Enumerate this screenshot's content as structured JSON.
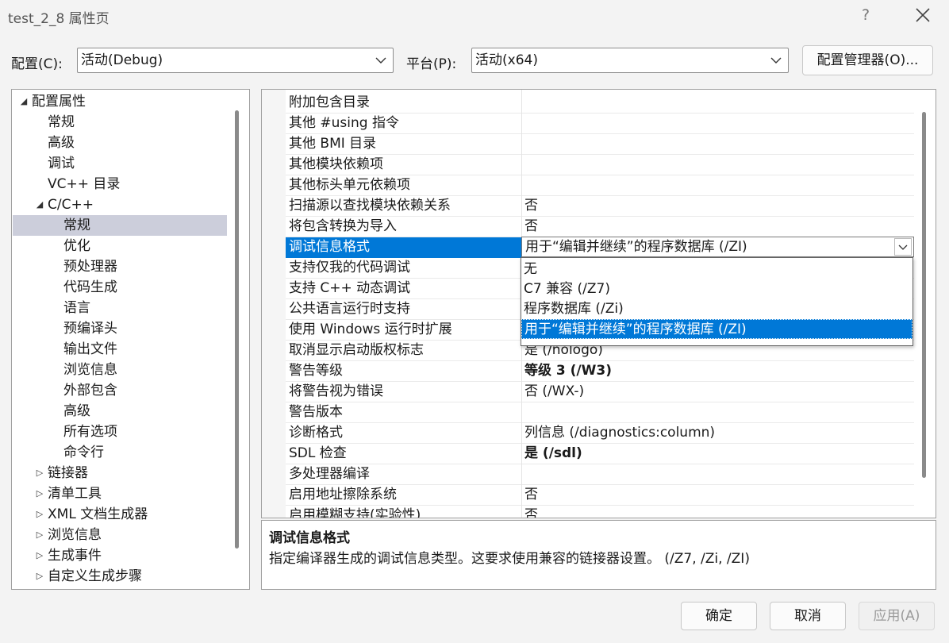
{
  "window": {
    "title": "test_2_8 属性页",
    "help_label": "?"
  },
  "config": {
    "config_label": "配置(C):",
    "config_value": "活动(Debug)",
    "platform_label": "平台(P):",
    "platform_value": "活动(x64)",
    "manager_label": "配置管理器(O)..."
  },
  "tree": {
    "items": [
      {
        "label": "配置属性",
        "toggle": "◢",
        "level": 0
      },
      {
        "label": "常规",
        "level": 1
      },
      {
        "label": "高级",
        "level": 1
      },
      {
        "label": "调试",
        "level": 1
      },
      {
        "label": "VC++ 目录",
        "level": 1
      },
      {
        "label": "C/C++",
        "toggle": "◢",
        "level": 1
      },
      {
        "label": "常规",
        "level": 2,
        "selected": true
      },
      {
        "label": "优化",
        "level": 2
      },
      {
        "label": "预处理器",
        "level": 2
      },
      {
        "label": "代码生成",
        "level": 2
      },
      {
        "label": "语言",
        "level": 2
      },
      {
        "label": "预编译头",
        "level": 2
      },
      {
        "label": "输出文件",
        "level": 2
      },
      {
        "label": "浏览信息",
        "level": 2
      },
      {
        "label": "外部包含",
        "level": 2
      },
      {
        "label": "高级",
        "level": 2
      },
      {
        "label": "所有选项",
        "level": 2
      },
      {
        "label": "命令行",
        "level": 2
      },
      {
        "label": "链接器",
        "toggle": "▷",
        "level": 1
      },
      {
        "label": "清单工具",
        "toggle": "▷",
        "level": 1
      },
      {
        "label": "XML 文档生成器",
        "toggle": "▷",
        "level": 1
      },
      {
        "label": "浏览信息",
        "toggle": "▷",
        "level": 1
      },
      {
        "label": "生成事件",
        "toggle": "▷",
        "level": 1
      },
      {
        "label": "自定义生成步骤",
        "toggle": "▷",
        "level": 1
      }
    ]
  },
  "grid": {
    "rows": [
      {
        "name": "附加包含目录",
        "value": ""
      },
      {
        "name": "其他 #using 指令",
        "value": ""
      },
      {
        "name": "其他 BMI 目录",
        "value": ""
      },
      {
        "name": "其他模块依赖项",
        "value": ""
      },
      {
        "name": "其他标头单元依赖项",
        "value": ""
      },
      {
        "name": "扫描源以查找模块依赖关系",
        "value": "否"
      },
      {
        "name": "将包含转换为导入",
        "value": "否"
      },
      {
        "name": "调试信息格式",
        "value": "",
        "selected": true
      },
      {
        "name": "支持仅我的代码调试",
        "value": ""
      },
      {
        "name": "支持 C++ 动态调试",
        "value": ""
      },
      {
        "name": "公共语言运行时支持",
        "value": ""
      },
      {
        "name": "使用 Windows 运行时扩展",
        "value": ""
      },
      {
        "name": "取消显示启动版权标志",
        "value": "是 (/nologo)"
      },
      {
        "name": "警告等级",
        "value": "等级 3 (/W3)",
        "bold": true
      },
      {
        "name": "将警告视为错误",
        "value": "否 (/WX-)"
      },
      {
        "name": "警告版本",
        "value": ""
      },
      {
        "name": "诊断格式",
        "value": "列信息 (/diagnostics:column)"
      },
      {
        "name": "SDL 检查",
        "value": "是 (/sdl)",
        "bold": true
      },
      {
        "name": "多处理器编译",
        "value": ""
      },
      {
        "name": "启用地址擦除系统",
        "value": "否"
      },
      {
        "name": "启用模糊支持(实验性)",
        "value": "否"
      }
    ],
    "selected_value": "用于“编辑并继续”的程序数据库 (/ZI)"
  },
  "dropdown": {
    "options": [
      {
        "label": "无"
      },
      {
        "label": "C7 兼容 (/Z7)"
      },
      {
        "label": "程序数据库 (/Zi)"
      },
      {
        "label": "用于“编辑并继续”的程序数据库 (/ZI)",
        "selected": true
      }
    ]
  },
  "description": {
    "title": "调试信息格式",
    "text": "指定编译器生成的调试信息类型。这要求使用兼容的链接器设置。 (/Z7, /Zi, /ZI)"
  },
  "buttons": {
    "ok": "确定",
    "cancel": "取消",
    "apply": "应用(A)"
  },
  "colors": {
    "selection": "#0078d7",
    "tree_selection": "#cccedb"
  }
}
